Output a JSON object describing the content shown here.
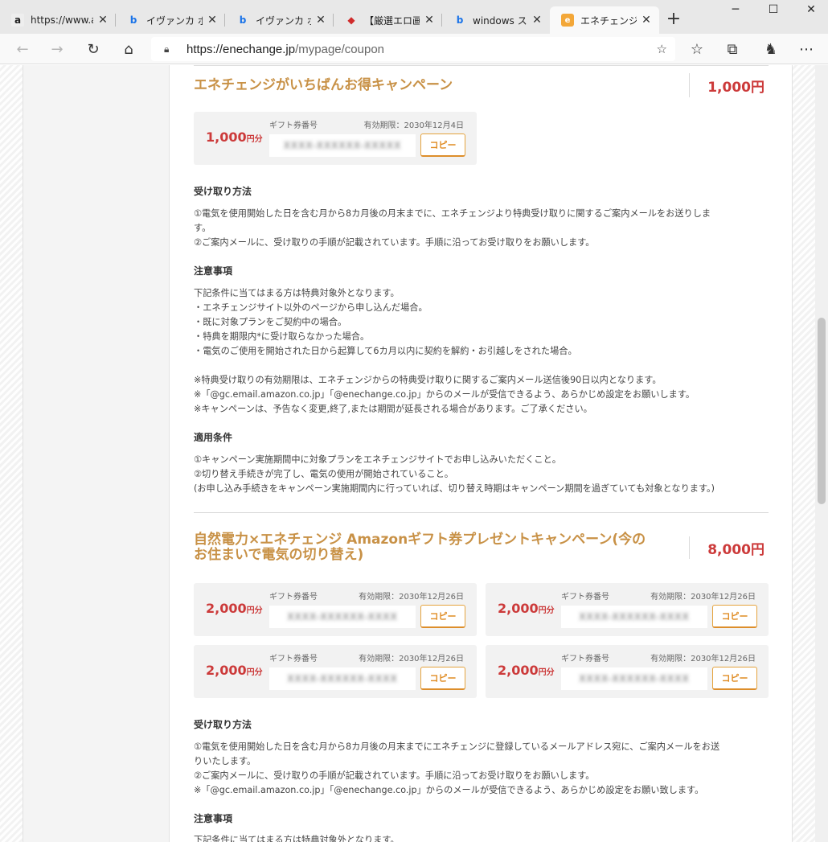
{
  "browser": {
    "tabs": [
      {
        "icon": "amazon-icon",
        "title": "https://www.a"
      },
      {
        "icon": "bing-icon",
        "title": "イヴァンカ ボロ"
      },
      {
        "icon": "bing-icon",
        "title": "イヴァンカ ボロ"
      },
      {
        "icon": "red-site-icon",
        "title": "【厳選エロ画像"
      },
      {
        "icon": "bing-icon",
        "title": "windows スポ"
      },
      {
        "icon": "enechange-icon",
        "title": "エネチェンジ限"
      }
    ],
    "address": {
      "host": "https://enechange.jp",
      "path": "/mypage/coupon"
    }
  },
  "campaign1": {
    "title": "エネチェンジがいちばんお得キャンペーン",
    "total": "1,000円",
    "cards": [
      {
        "amount": "1,000",
        "unit": "円分",
        "label": "ギフト券番号",
        "expiry": "有効期限：2030年12月4日",
        "code": "XXXX-XXXXXX-XXXXX",
        "copy": "コピー"
      }
    ],
    "receive_heading": "受け取り方法",
    "receive_lines": [
      "①電気を使用開始した日を含む月から8カ月後の月末までに、エネチェンジより特典受け取りに関するご案内メールをお送りしま",
      "す。",
      "②ご案内メールに、受け取りの手順が記載されています。手順に沿ってお受け取りをお願いします。"
    ],
    "notes_heading": "注意事項",
    "notes_lines": [
      "下記条件に当てはまる方は特典対象外となります。",
      "・エネチェンジサイト以外のページから申し込んだ場合。",
      "・既に対象プランをご契約中の場合。",
      "・特典を期限内*に受け取らなかった場合。",
      "・電気のご使用を開始された日から起算して6カ月以内に契約を解約・お引越しをされた場合。"
    ],
    "notes_lines2": [
      "※特典受け取りの有効期限は、エネチェンジからの特典受け取りに関するご案内メール送信後90日以内となります。",
      "※「@gc.email.amazon.co.jp」「@enechange.co.jp」からのメールが受信できるよう、あらかじめ設定をお願いします。",
      "※キャンペーンは、予告なく変更,終了,または期間が延長される場合があります。ご了承ください。"
    ],
    "cond_heading": "適用条件",
    "cond_lines": [
      "①キャンペーン実施期間中に対象プランをエネチェンジサイトでお申し込みいただくこと。",
      "②切り替え手続きが完了し、電気の使用が開始されていること。",
      "(お申し込み手続きをキャンペーン実施期間内に行っていれば、切り替え時期はキャンペーン期間を過ぎていても対象となります。)"
    ]
  },
  "campaign2": {
    "title_line1": "自然電力×エネチェンジ Amazonギフト券プレゼントキャンペーン(今の",
    "title_line2": "お住まいで電気の切り替え)",
    "total": "8,000円",
    "cards": [
      {
        "amount": "2,000",
        "unit": "円分",
        "label": "ギフト券番号",
        "expiry": "有効期限：2030年12月26日",
        "code": "XXXX-XXXXXX-XXXX",
        "copy": "コピー"
      },
      {
        "amount": "2,000",
        "unit": "円分",
        "label": "ギフト券番号",
        "expiry": "有効期限：2030年12月26日",
        "code": "XXXX-XXXXXX-XXXX",
        "copy": "コピー"
      },
      {
        "amount": "2,000",
        "unit": "円分",
        "label": "ギフト券番号",
        "expiry": "有効期限：2030年12月26日",
        "code": "XXXX-XXXXXX-XXXX",
        "copy": "コピー"
      },
      {
        "amount": "2,000",
        "unit": "円分",
        "label": "ギフト券番号",
        "expiry": "有効期限：2030年12月26日",
        "code": "XXXX-XXXXXX-XXXX",
        "copy": "コピー"
      }
    ],
    "receive_heading": "受け取り方法",
    "receive_lines": [
      "①電気を使用開始した日を含む月から8カ月後の月末までにエネチェンジに登録しているメールアドレス宛に、ご案内メールをお送",
      "りいたします。",
      "②ご案内メールに、受け取りの手順が記載されています。手順に沿ってお受け取りをお願いします。",
      "※「@gc.email.amazon.co.jp」「@enechange.co.jp」からのメールが受信できるよう、あらかじめ設定をお願い致します。"
    ],
    "notes_heading": "注意事項",
    "notes_first": "下記条件に当てはまる方は特典対象外となります。"
  },
  "colors": {
    "title": "#c89146",
    "amount": "#cc3a3a",
    "copy_border": "#e5a33e"
  }
}
